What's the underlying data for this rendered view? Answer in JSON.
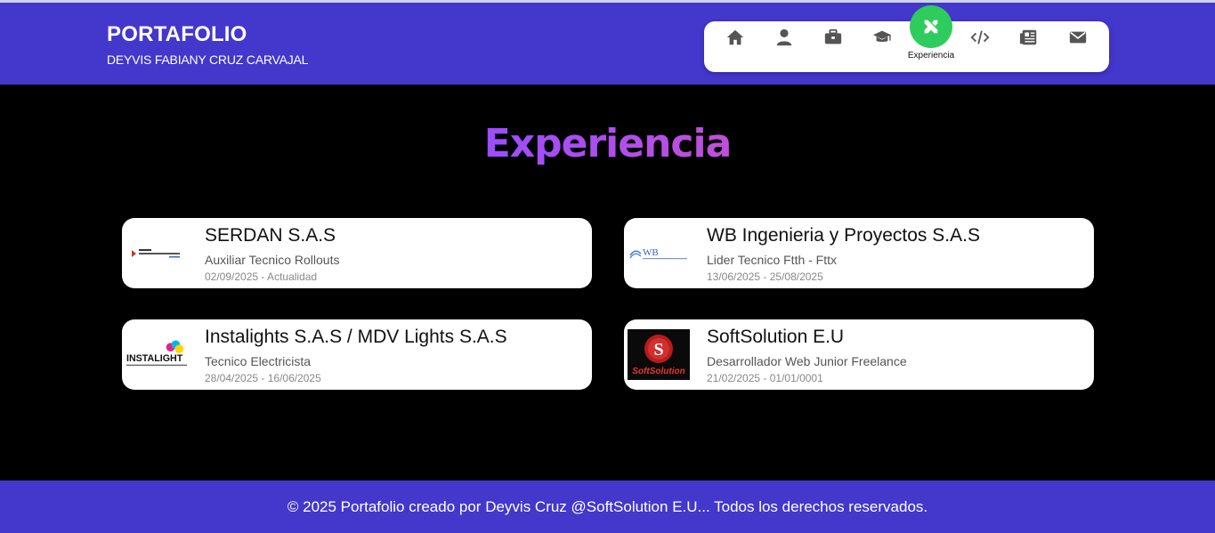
{
  "header": {
    "title": "PORTAFOLIO",
    "subtitle": "DEYVIS FABIANY CRUZ CARVAJAL"
  },
  "nav": {
    "active_label": "Experiencia",
    "items": [
      {
        "icon": "home-icon"
      },
      {
        "icon": "user-icon"
      },
      {
        "icon": "briefcase-icon"
      },
      {
        "icon": "graduation-cap-icon"
      },
      {
        "icon": "tools-icon",
        "label": "Experiencia",
        "active": true
      },
      {
        "icon": "code-icon"
      },
      {
        "icon": "newspaper-icon"
      },
      {
        "icon": "envelope-icon"
      }
    ]
  },
  "section": {
    "title": "Experiencia"
  },
  "experiences": [
    {
      "company": "SERDAN S.A.S",
      "role": "Auxiliar Tecnico Rollouts",
      "dates": "02/09/2025 - Actualidad",
      "logo": "serdan-logo"
    },
    {
      "company": "WB Ingenieria y Proyectos S.A.S",
      "role": "Lider Tecnico Ftth - Fttx",
      "dates": "13/06/2025 - 25/08/2025",
      "logo": "wb-logo",
      "logo_text": "WB"
    },
    {
      "company": "Instalights S.A.S / MDV Lights S.A.S",
      "role": "Tecnico Electricista",
      "dates": "28/04/2025 - 16/06/2025",
      "logo": "instalight-logo",
      "logo_text": "INSTALIGHT"
    },
    {
      "company": "SoftSolution E.U",
      "role": "Desarrollador Web Junior Freelance",
      "dates": "21/02/2025 - 01/01/0001",
      "logo": "softsolution-logo",
      "logo_text": "SoftSolution"
    }
  ],
  "footer": {
    "text": "© 2025 Portafolio creado por Deyvis Cruz @SoftSolution E.U... Todos los derechos reservados."
  },
  "colors": {
    "header_bg": "#4337cc",
    "nav_active": "#2ecc5c",
    "title_gradient_start": "#9b4dff",
    "title_gradient_end": "#c050d8"
  }
}
